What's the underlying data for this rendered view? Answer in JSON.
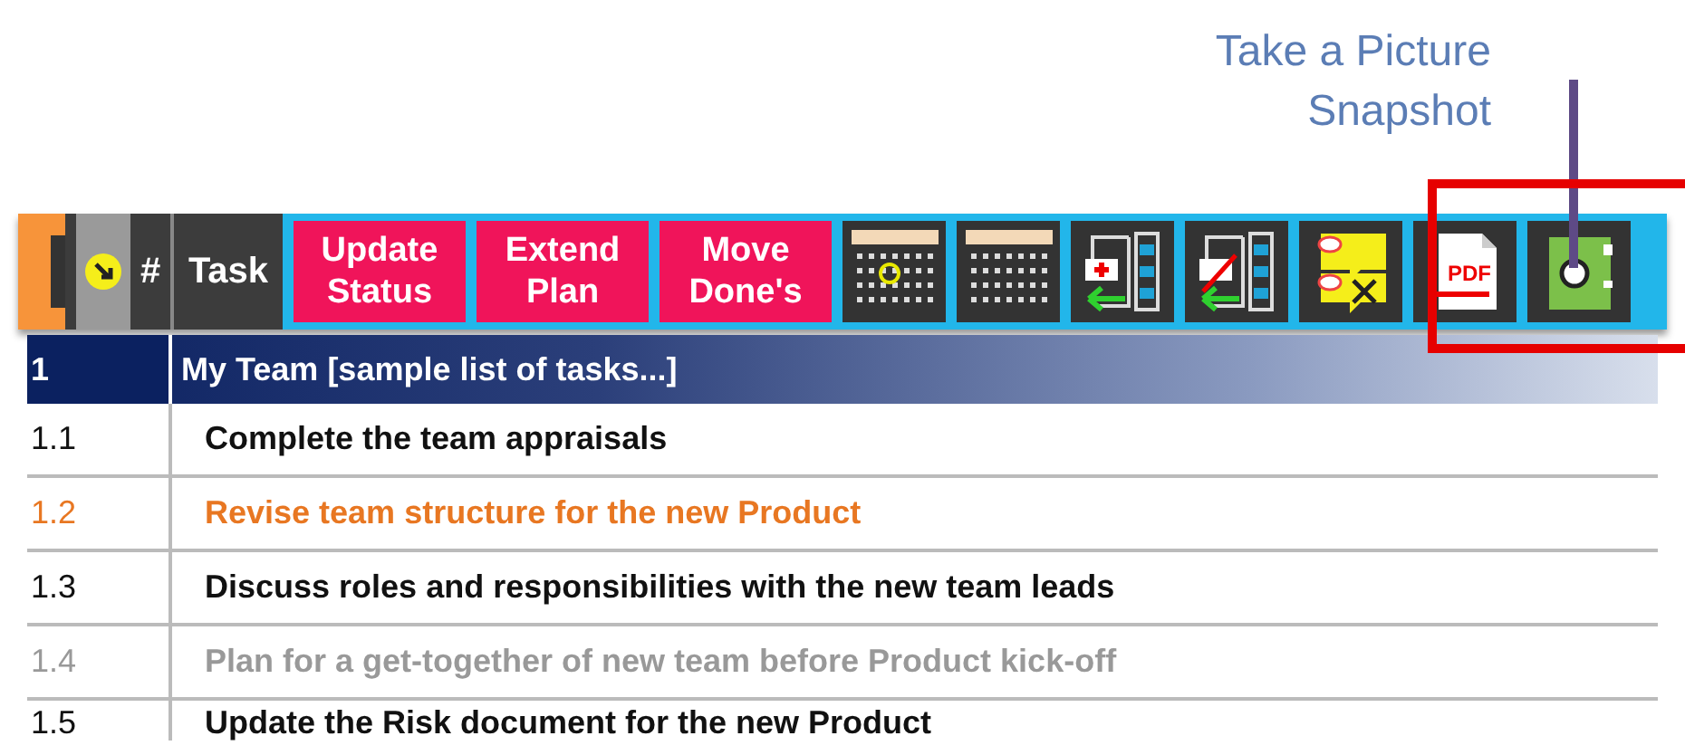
{
  "callout": {
    "lines": [
      "Take a Picture",
      "Snapshot"
    ]
  },
  "toolbar": {
    "number_header": "#",
    "task_header": "Task",
    "buttons": [
      {
        "kind": "text",
        "lines": [
          "Update",
          "Status"
        ]
      },
      {
        "kind": "text",
        "lines": [
          "Extend",
          "Plan"
        ]
      },
      {
        "kind": "text",
        "lines": [
          "Move",
          "Done's"
        ]
      },
      {
        "kind": "calendar-marked"
      },
      {
        "kind": "calendar"
      },
      {
        "kind": "add-rows"
      },
      {
        "kind": "remove-rows"
      },
      {
        "kind": "notes"
      },
      {
        "kind": "pdf",
        "label": "PDF"
      },
      {
        "kind": "camera",
        "highlighted": true
      }
    ]
  },
  "group": {
    "number": "1",
    "title": "My Team [sample list of tasks...]"
  },
  "rows": [
    {
      "number": "1.1",
      "task": "Complete the team appraisals",
      "kind": "open"
    },
    {
      "number": "1.2",
      "task": "Revise team structure for the new Product",
      "kind": "in-progress"
    },
    {
      "number": "1.3",
      "task": "Discuss roles and responsibilities with the new team leads",
      "kind": "open"
    },
    {
      "number": "1.4",
      "task": "Plan for a get-together of new team before Product kick-off",
      "kind": "done"
    },
    {
      "number": "1.5",
      "task": "Update the Risk document for the new Product",
      "kind": "open"
    }
  ]
}
